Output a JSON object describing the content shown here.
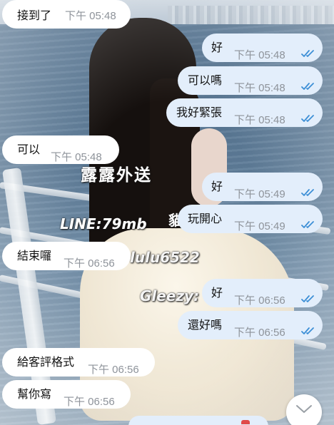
{
  "watermark": {
    "brand": "露露外送",
    "line_id": "LINE:79mb",
    "id_text": "lulu6522",
    "gleezy": "Gleezy:",
    "fragment": "貓"
  },
  "messages": [
    {
      "dir": "in",
      "text": "接到了",
      "time": "下午 05:48",
      "read": false
    },
    {
      "dir": "out",
      "text": "好",
      "time": "下午 05:48",
      "read": true
    },
    {
      "dir": "out",
      "text": "可以嗎",
      "time": "下午 05:48",
      "read": true
    },
    {
      "dir": "out",
      "text": "我好緊張",
      "time": "下午 05:48",
      "read": true
    },
    {
      "dir": "in",
      "text": "可以",
      "time": "下午 05:48",
      "read": false
    },
    {
      "dir": "out",
      "text": "好",
      "time": "下午 05:49",
      "read": true
    },
    {
      "dir": "out",
      "text": "玩開心",
      "time": "下午 05:49",
      "read": true
    },
    {
      "dir": "in",
      "text": "結束囉",
      "time": "下午 06:56",
      "read": false
    },
    {
      "dir": "out",
      "text": "好",
      "time": "下午 06:56",
      "read": true
    },
    {
      "dir": "out",
      "text": "還好嗎",
      "time": "下午 06:56",
      "read": true
    },
    {
      "dir": "in",
      "text": "給客評格式",
      "time": "下午 06:56",
      "read": false
    },
    {
      "dir": "in",
      "text": "幫你寫",
      "time": "下午 06:56",
      "read": false
    }
  ],
  "icons": {
    "read_receipt": "double-check-icon",
    "scroll_down": "chevron-down-icon"
  },
  "colors": {
    "incoming_bubble": "#ffffff",
    "outgoing_bubble": "#e3eefb",
    "read_check": "#3d8fd6",
    "time_text": "#8e939a"
  }
}
